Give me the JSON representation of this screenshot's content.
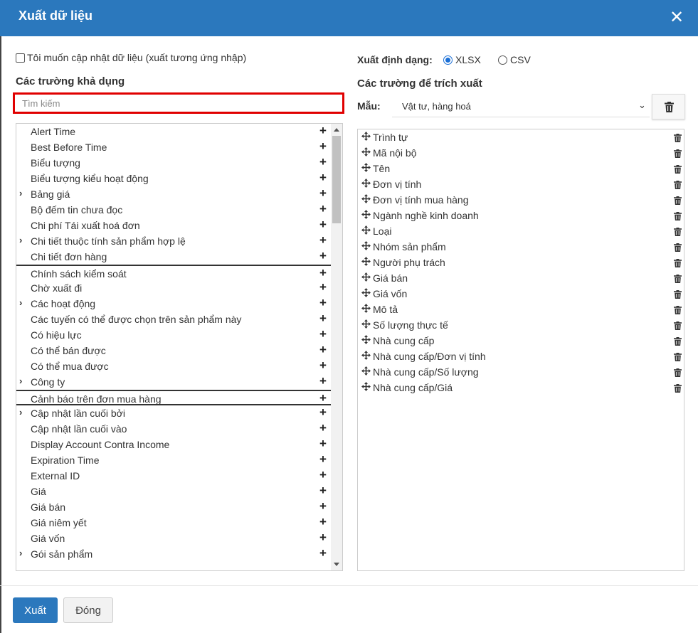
{
  "dialog": {
    "title": "Xuất dữ liệu",
    "close_icon": "close-icon"
  },
  "left": {
    "update_checkbox_label": "Tôi muốn cập nhật dữ liệu (xuất tương ứng nhập)",
    "available_title": "Các trường khả dụng",
    "search_placeholder": "Tìm kiếm",
    "available_fields": [
      {
        "label": "Alert Time",
        "expandable": false
      },
      {
        "label": "Best Before Time",
        "expandable": false
      },
      {
        "label": "Biểu tượng",
        "expandable": false
      },
      {
        "label": "Biểu tượng kiểu hoạt động",
        "expandable": false
      },
      {
        "label": "Bảng giá",
        "expandable": true
      },
      {
        "label": "Bộ đếm tin chưa đọc",
        "expandable": false
      },
      {
        "label": "Chi phí Tái xuất hoá đơn",
        "expandable": false
      },
      {
        "label": "Chi tiết thuộc tính sản phẩm hợp lệ",
        "expandable": true
      },
      {
        "label": "Chi tiết đơn hàng",
        "expandable": false
      },
      {
        "label": "Chính sách kiểm soát",
        "expandable": false
      },
      {
        "label": "Chờ xuất đi",
        "expandable": false
      },
      {
        "label": "Các hoạt động",
        "expandable": true
      },
      {
        "label": "Các tuyến có thể được chọn trên sản phẩm này",
        "expandable": false
      },
      {
        "label": "Có hiệu lực",
        "expandable": false
      },
      {
        "label": "Có thể bán được",
        "expandable": false
      },
      {
        "label": "Có thể mua được",
        "expandable": false
      },
      {
        "label": "Công ty",
        "expandable": true
      },
      {
        "label": "Cảnh báo trên đơn mua hàng",
        "expandable": false
      },
      {
        "label": "Cập nhật lần cuối bởi",
        "expandable": true
      },
      {
        "label": "Cập nhật lần cuối vào",
        "expandable": false
      },
      {
        "label": "Display Account Contra Income",
        "expandable": false
      },
      {
        "label": "Expiration Time",
        "expandable": false
      },
      {
        "label": "External ID",
        "expandable": false
      },
      {
        "label": "Giá",
        "expandable": false
      },
      {
        "label": "Giá bán",
        "expandable": false
      },
      {
        "label": "Giá niêm yết",
        "expandable": false
      },
      {
        "label": "Giá vốn",
        "expandable": false
      },
      {
        "label": "Gói sản phẩm",
        "expandable": true
      }
    ]
  },
  "right": {
    "format_label": "Xuất định dạng:",
    "format_options": [
      "XLSX",
      "CSV"
    ],
    "format_selected": "XLSX",
    "export_title": "Các trường để trích xuất",
    "template_label": "Mẫu:",
    "template_value": "Vật tư, hàng hoá",
    "export_fields": [
      "Trình tự",
      "Mã nội bộ",
      "Tên",
      "Đơn vị tính",
      "Đơn vị tính mua hàng",
      "Ngành nghề kinh doanh",
      "Loại",
      "Nhóm sản phẩm",
      "Người phụ trách",
      "Giá bán",
      "Giá vốn",
      "Mô tả",
      "Số lượng thực tế",
      "Nhà cung cấp",
      "Nhà cung cấp/Đơn vị tính",
      "Nhà cung cấp/Số lượng",
      "Nhà cung cấp/Giá"
    ]
  },
  "footer": {
    "export_label": "Xuất",
    "close_label": "Đóng"
  },
  "colors": {
    "header": "#2b78bd",
    "highlight_border": "#e00000",
    "radio_accent": "#1a6fd6"
  }
}
